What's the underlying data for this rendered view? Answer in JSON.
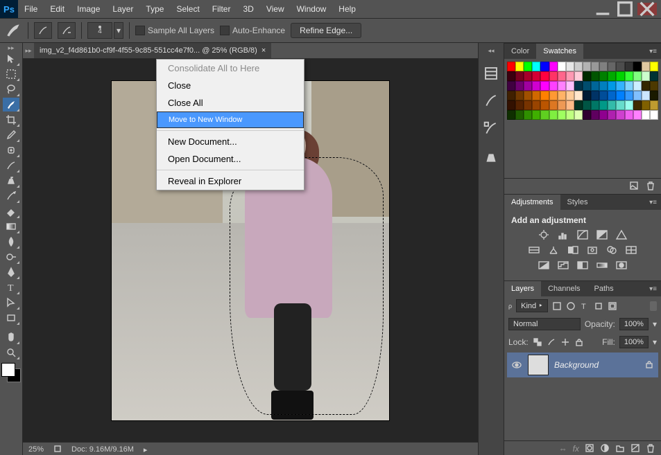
{
  "menu": {
    "file": "File",
    "edit": "Edit",
    "image": "Image",
    "layer": "Layer",
    "type": "Type",
    "select": "Select",
    "filter": "Filter",
    "threeD": "3D",
    "view": "View",
    "window": "Window",
    "help": "Help"
  },
  "options": {
    "brush_size": "4",
    "sample_all": "Sample All Layers",
    "auto_enhance": "Auto-Enhance",
    "refine": "Refine Edge..."
  },
  "doc": {
    "tab_label": "img_v2_f4d861b0-cf9f-4f55-9c85-551cc4e7f0... @ 25% (RGB/8)",
    "zoom": "25%",
    "doc_size": "Doc: 9.16M/9.16M"
  },
  "context_menu": {
    "consolidate": "Consolidate All to Here",
    "close": "Close",
    "close_all": "Close All",
    "move_new": "Move to New Window",
    "new_doc": "New Document...",
    "open_doc": "Open Document...",
    "reveal": "Reveal in Explorer"
  },
  "panels": {
    "color": "Color",
    "swatches": "Swatches",
    "adjustments": "Adjustments",
    "styles": "Styles",
    "add_adjustment": "Add an adjustment",
    "layers": "Layers",
    "channels": "Channels",
    "paths": "Paths",
    "kind": "Kind",
    "blend": "Normal",
    "opacity_label": "Opacity:",
    "opacity_val": "100%",
    "fill_label": "Fill:",
    "fill_val": "100%",
    "lock_label": "Lock:",
    "layer_name": "Background"
  },
  "swatch_colors": [
    [
      "#ff0000",
      "#ffff00",
      "#00ff00",
      "#00ffff",
      "#0000ff",
      "#ff00ff",
      "#ffffff",
      "#e6e6e6",
      "#cccccc",
      "#b3b3b3",
      "#999999",
      "#808080",
      "#666666",
      "#4d4d4d",
      "#333333",
      "#000000",
      "#e0c8a0",
      "#ffff00"
    ],
    [
      "#3b000f",
      "#7a001f",
      "#a8002a",
      "#d40035",
      "#ff0040",
      "#ff3366",
      "#ff668c",
      "#ff99b3",
      "#ffccd9",
      "#002b00",
      "#005500",
      "#008000",
      "#00aa00",
      "#00d400",
      "#33ff33",
      "#80ff80",
      "#ccffcc",
      "#003333"
    ],
    [
      "#400040",
      "#700070",
      "#a000a0",
      "#d000d0",
      "#ff00ff",
      "#ff40ff",
      "#ff80ff",
      "#ffc0ff",
      "#003349",
      "#004d6e",
      "#006699",
      "#0080bf",
      "#0099e6",
      "#33b3ff",
      "#80d4ff",
      "#cceeff",
      "#332600",
      "#4d3900"
    ],
    [
      "#402000",
      "#703800",
      "#a05000",
      "#d06800",
      "#ff8000",
      "#ff9933",
      "#ffb366",
      "#ffcc99",
      "#ffe6cc",
      "#001a33",
      "#003366",
      "#004d99",
      "#0066cc",
      "#0080ff",
      "#3399ff",
      "#80bfff",
      "#cce6ff",
      "#1a1a00"
    ],
    [
      "#331100",
      "#552200",
      "#773300",
      "#994400",
      "#bb5500",
      "#dd7722",
      "#ee9955",
      "#ffbb88",
      "#003322",
      "#005544",
      "#007766",
      "#009988",
      "#33bbaa",
      "#66ddcc",
      "#99ffee",
      "#402b00",
      "#806000",
      "#bf9b30"
    ],
    [
      "#0f2f00",
      "#1f5f00",
      "#2f8f00",
      "#3faf00",
      "#5fcf20",
      "#7fef40",
      "#9fff60",
      "#bfff80",
      "#dfffb0",
      "#2f002f",
      "#5f005f",
      "#8f008f",
      "#af20af",
      "#cf40cf",
      "#ef60ef",
      "#ff80ff",
      "#ffffff",
      "#ffffff"
    ]
  ]
}
